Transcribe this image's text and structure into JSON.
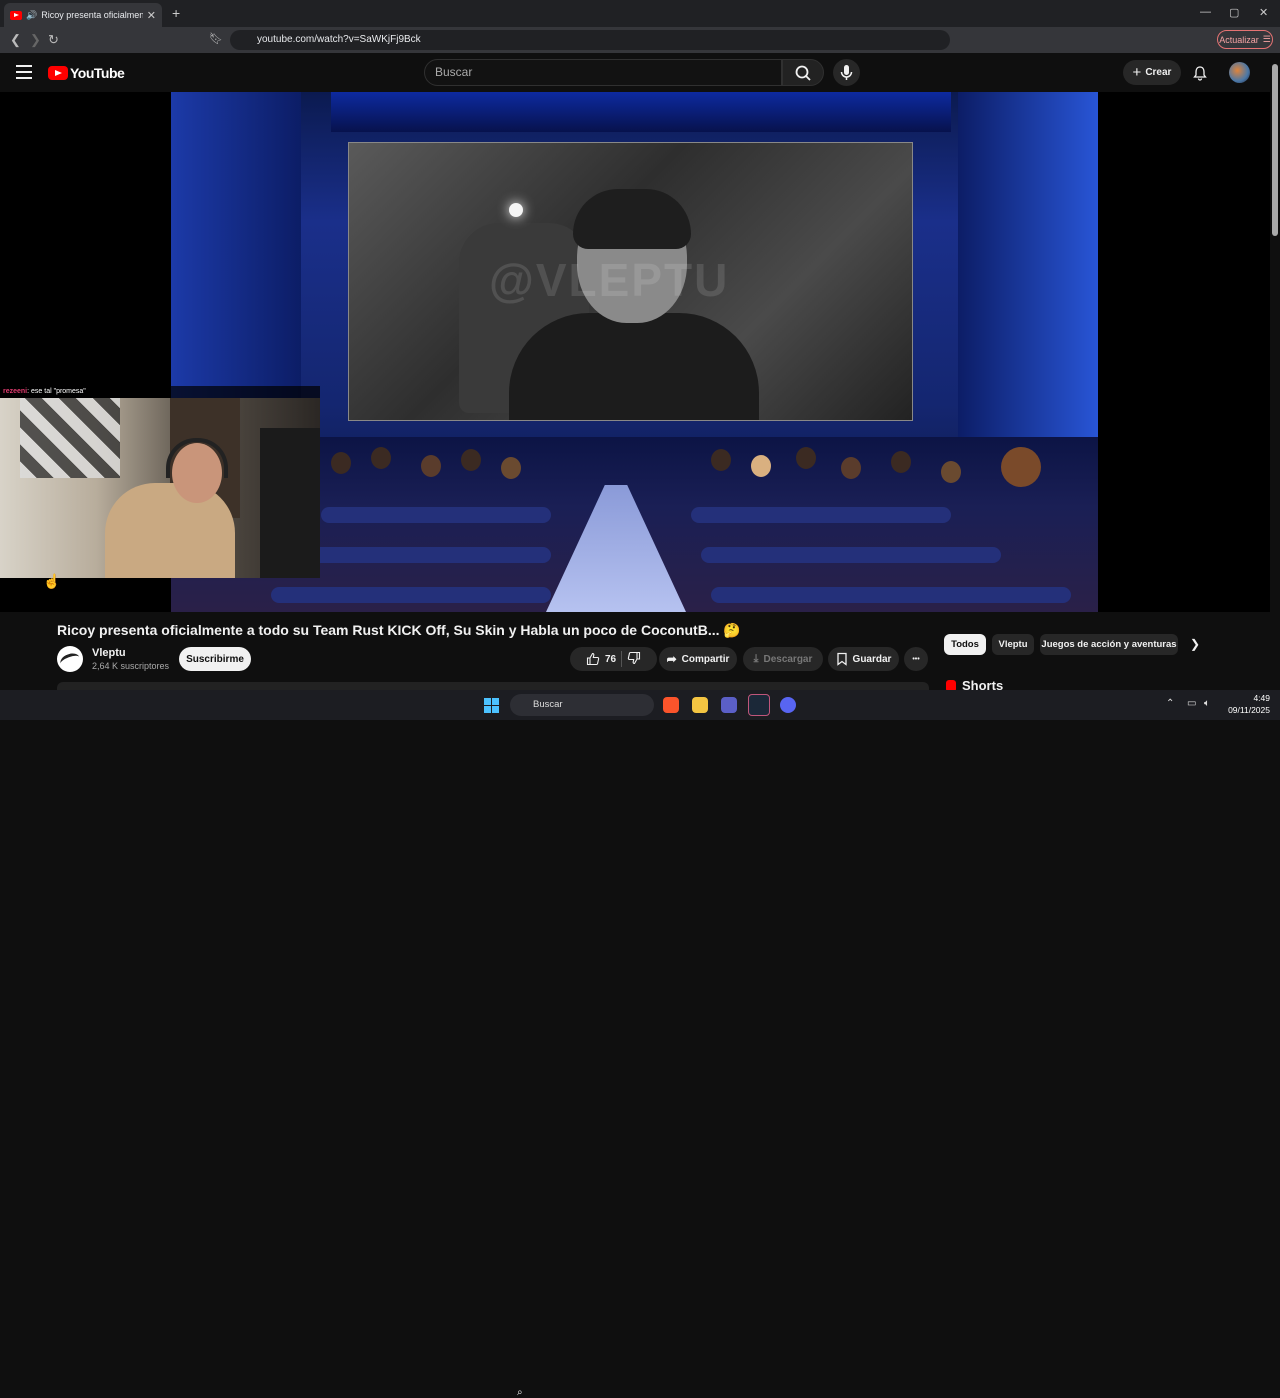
{
  "browser": {
    "tab_title": "Ricoy presenta oficialmente a",
    "tab_close": "✕",
    "new_tab": "+",
    "url": "youtube.com/watch?v=SaWKjFj9Bck",
    "update_label": "Actualizar",
    "window_controls": [
      "—",
      "▢",
      "✕"
    ]
  },
  "youtube": {
    "logo_text": "YouTube",
    "search_placeholder": "Buscar",
    "create_label": "Crear"
  },
  "stream_overlay": {
    "chat_user": "rezeeni",
    "chat_message": ": ese tal \"promesa\"",
    "watermark": "@VLEPTU"
  },
  "video": {
    "title": "Ricoy presenta oficialmente a todo su Team Rust KICK Off, Su Skin y Habla un poco de CoconutB... 🤔",
    "channel_name": "Vleptu",
    "subscribers": "2,64 K suscriptores",
    "subscribe_label": "Suscribirme",
    "like_count": "76",
    "share_label": "Compartir",
    "download_label": "Descargar",
    "save_label": "Guardar",
    "more_label": "•••"
  },
  "sidebar": {
    "chips": [
      "Todos",
      "Vleptu",
      "Juegos de acción y aventuras"
    ],
    "shorts_label": "Shorts"
  },
  "taskbar": {
    "search_placeholder": "Buscar",
    "time": "4:49",
    "date": "09/11/2025"
  },
  "colors": {
    "youtube_red": "#ff0000",
    "background": "#0f0f0f",
    "accent_blue": "#4cc2ff"
  }
}
